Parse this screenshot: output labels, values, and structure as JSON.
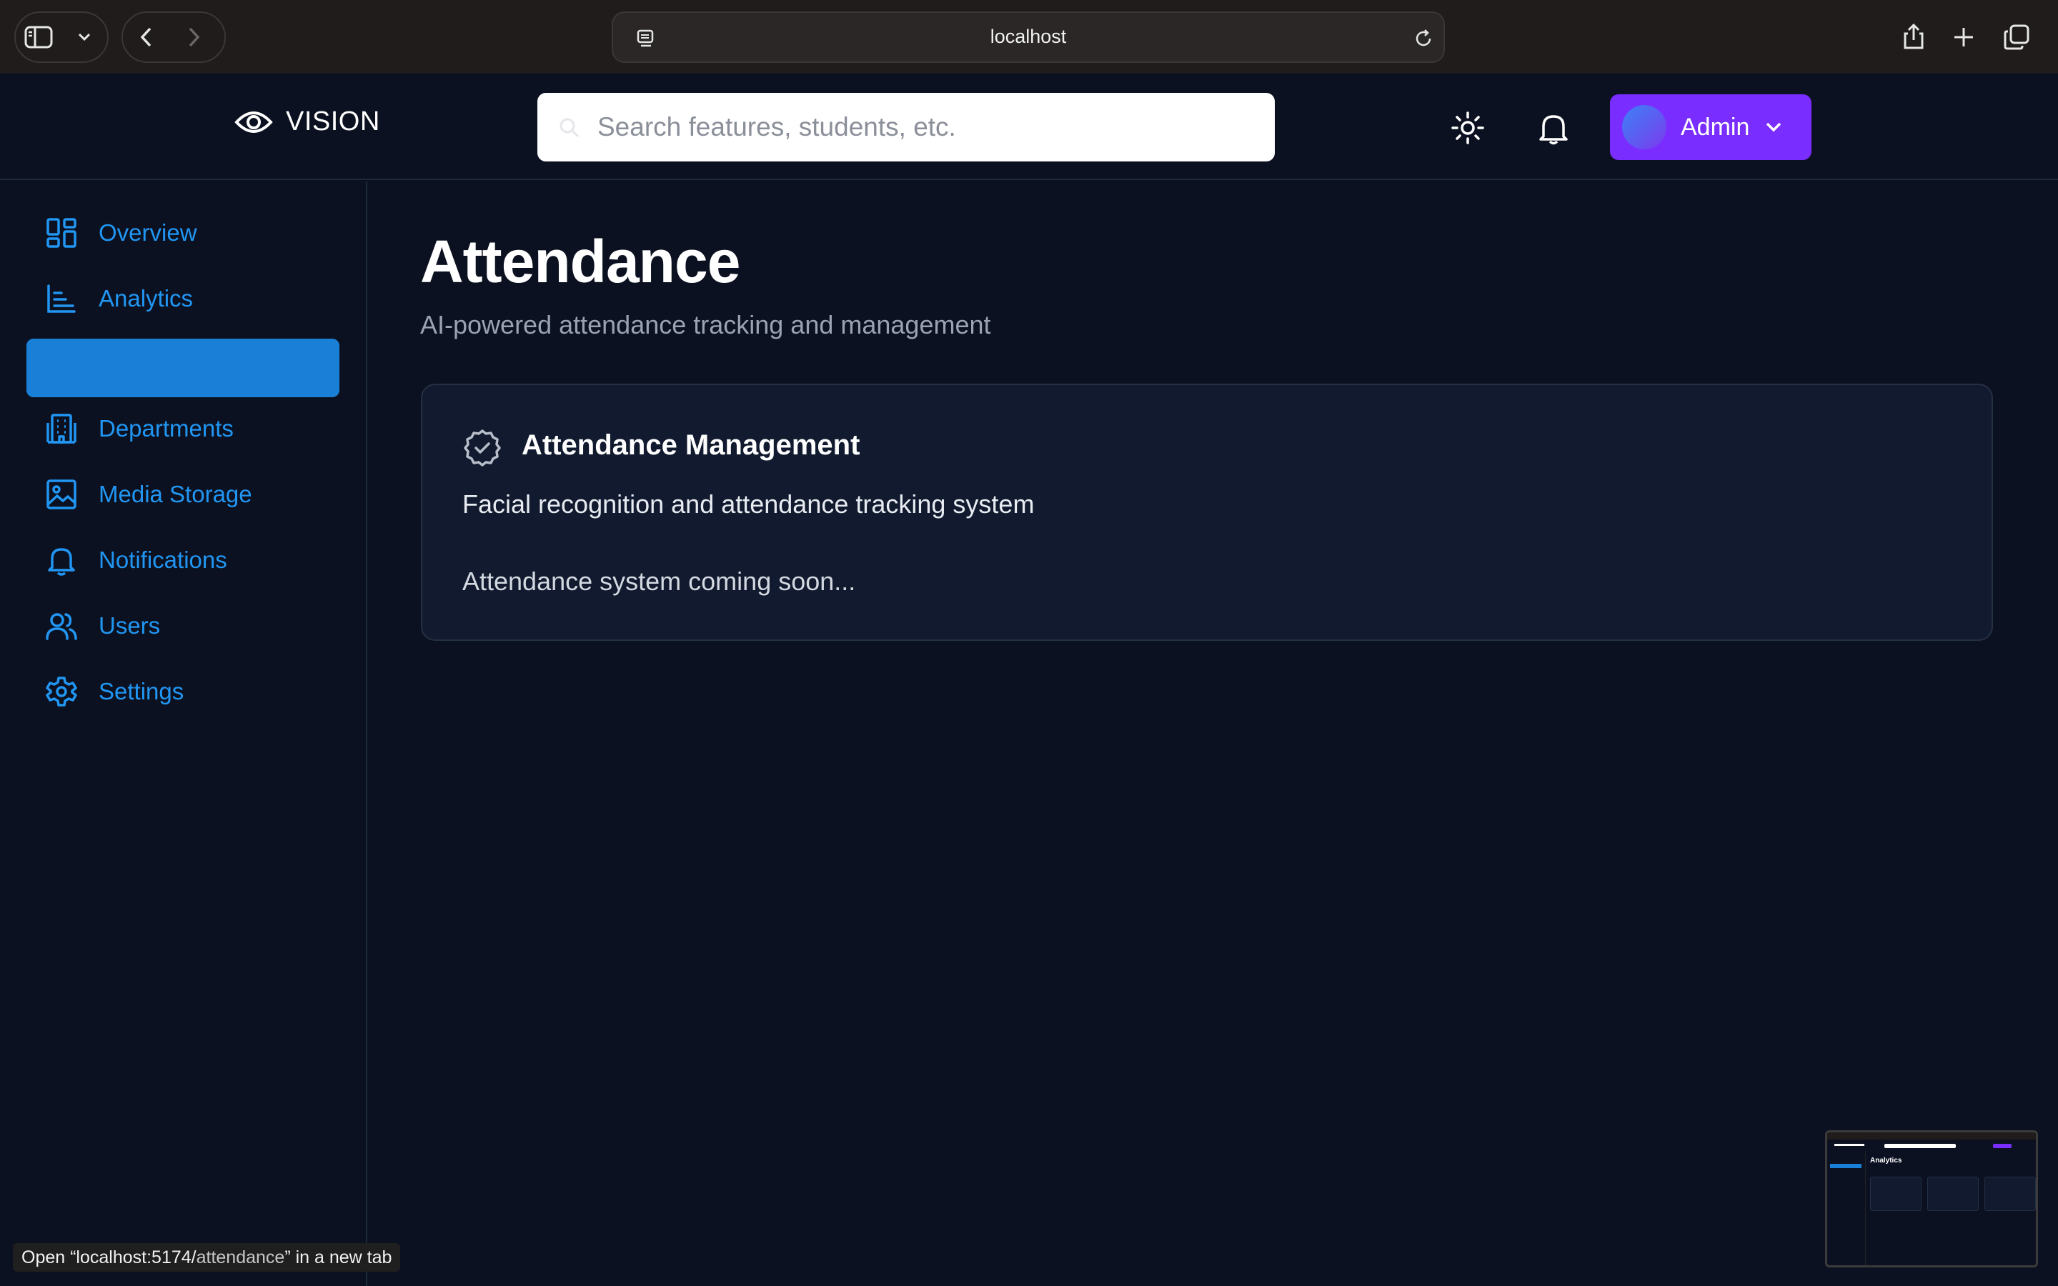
{
  "browser": {
    "url": "localhost"
  },
  "app": {
    "brand": "VISION",
    "search_placeholder": "Search features, students, etc.",
    "admin_label": "Admin"
  },
  "sidebar": {
    "items": [
      {
        "label": "Overview",
        "icon": "grid-icon"
      },
      {
        "label": "Analytics",
        "icon": "bar-chart-icon"
      },
      {
        "label": "",
        "icon": "",
        "active": true
      },
      {
        "label": "Departments",
        "icon": "building-icon"
      },
      {
        "label": "Media Storage",
        "icon": "image-icon"
      },
      {
        "label": "Notifications",
        "icon": "bell-icon"
      },
      {
        "label": "Users",
        "icon": "users-icon"
      },
      {
        "label": "Settings",
        "icon": "gear-icon"
      }
    ]
  },
  "main": {
    "title": "Attendance",
    "subtitle": "AI-powered attendance tracking and management",
    "card": {
      "title": "Attendance Management",
      "description": "Facial recognition and attendance tracking system",
      "body": "Attendance system coming soon..."
    }
  },
  "thumbnail": {
    "title": "Analytics"
  },
  "status_bar": {
    "prefix": "Open “localhost:5174/",
    "path": "attendance",
    "suffix": "” in a new tab"
  },
  "colors": {
    "background": "#0b1120",
    "accent_blue": "#2196f3",
    "active_blue": "#1a7fd6",
    "admin_purple": "#7a2dff",
    "card_bg": "#111a2e"
  }
}
